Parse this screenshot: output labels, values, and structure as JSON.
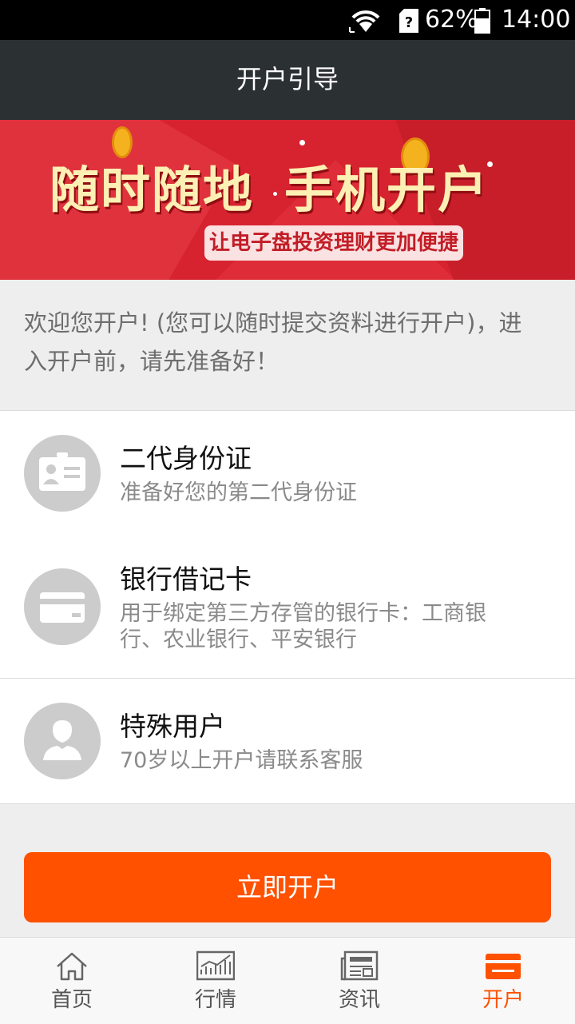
{
  "status_bar": {
    "battery": "62%",
    "time": "14:00",
    "icons": [
      "wifi-icon",
      "sim-unknown-icon",
      "battery-icon"
    ]
  },
  "header": {
    "title": "开户引导"
  },
  "banner": {
    "headline_left": "随时随地",
    "headline_right": "手机开户",
    "slogan": "让电子盘投资理财更加便捷"
  },
  "intro": {
    "text": "欢迎您开户! (您可以随时提交资料进行开户)，进入开户前，请先准备好！"
  },
  "requirements": [
    {
      "icon": "id-card-icon",
      "title": "二代身份证",
      "desc": "准备好您的第二代身份证"
    },
    {
      "icon": "bank-card-icon",
      "title": "银行借记卡",
      "desc": "用于绑定第三方存管的银行卡：工商银行、农业银行、平安银行"
    },
    {
      "icon": "user-icon",
      "title": "特殊用户",
      "desc": "70岁以上开户请联系客服"
    }
  ],
  "cta": {
    "label": "立即开户"
  },
  "tabs": [
    {
      "label": "首页",
      "icon": "home-icon",
      "active": false
    },
    {
      "label": "行情",
      "icon": "market-chart-icon",
      "active": false
    },
    {
      "label": "资讯",
      "icon": "news-icon",
      "active": false
    },
    {
      "label": "开户",
      "icon": "open-account-icon",
      "active": true
    }
  ],
  "colors": {
    "accent": "#ff5100",
    "header_bg": "#2b3033",
    "banner_red": "#d6232f",
    "banner_text": "#fdf0b4",
    "icon_gray": "#cccccc"
  }
}
